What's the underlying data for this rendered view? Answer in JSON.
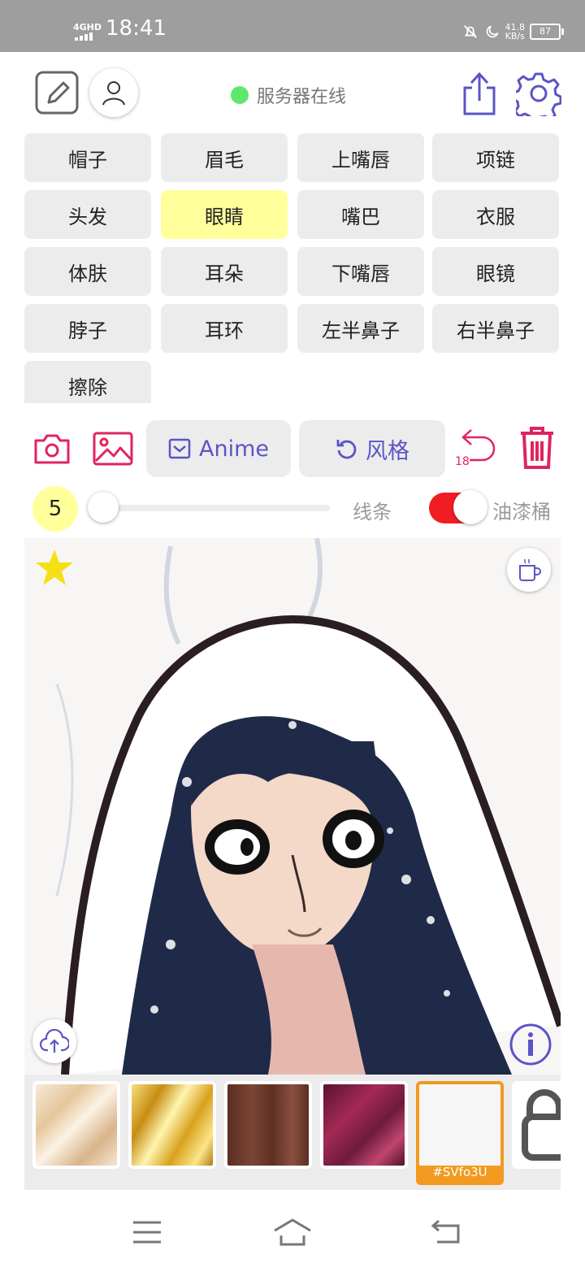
{
  "status_bar": {
    "network": "4GHD",
    "time": "18:41",
    "speed_value": "41.8",
    "speed_unit": "KB/s",
    "battery": "87"
  },
  "header": {
    "server_status": "服务器在线"
  },
  "parts": [
    "帽子",
    "眉毛",
    "上嘴唇",
    "项链",
    "头发",
    "眼睛",
    "嘴巴",
    "衣服",
    "体肤",
    "耳朵",
    "下嘴唇",
    "眼镜",
    "脖子",
    "耳环",
    "左半鼻子",
    "右半鼻子",
    "擦除"
  ],
  "selected_part": "眼睛",
  "toolbar": {
    "anime_label": "Anime",
    "style_label": "风格",
    "undo_count": "18"
  },
  "brush": {
    "size": "5",
    "slider_value": 0,
    "line_label": "线条",
    "bucket_label": "油漆桶",
    "bucket_enabled": true
  },
  "palette": {
    "selected_code": "#SVfo3U"
  },
  "colors": {
    "accent_pink": "#e0245e",
    "accent_purple": "#5b54c6",
    "selected_chip": "#ffff9c",
    "online": "#5ee86a",
    "toggle_on": "#f01d24",
    "selected_swatch": "#f19a1f"
  }
}
